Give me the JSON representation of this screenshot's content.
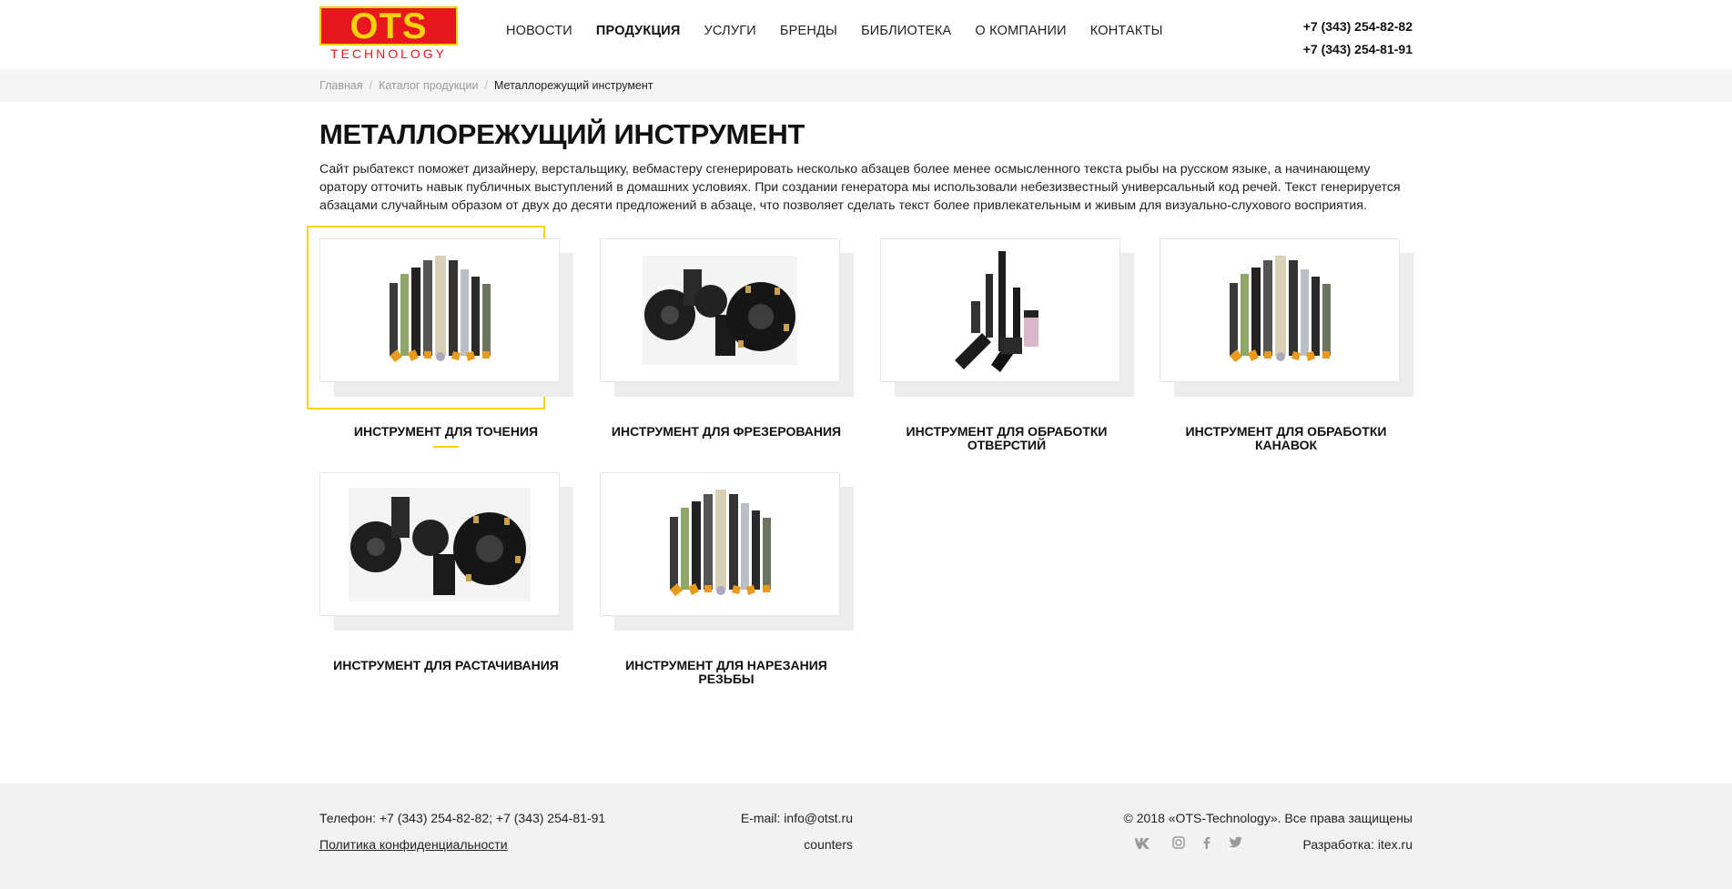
{
  "header": {
    "logo_top": "OTS",
    "logo_bottom": "TECHNOLOGY",
    "nav": [
      {
        "label": "НОВОСТИ",
        "active": false
      },
      {
        "label": "ПРОДУКЦИЯ",
        "active": true
      },
      {
        "label": "УСЛУГИ",
        "active": false
      },
      {
        "label": "БРЕНДЫ",
        "active": false
      },
      {
        "label": "БИБЛИОТЕКА",
        "active": false
      },
      {
        "label": "О КОМПАНИИ",
        "active": false
      },
      {
        "label": "КОНТАКТЫ",
        "active": false
      }
    ],
    "phones": [
      "+7 (343) 254-82-82",
      "+7 (343) 254-81-91"
    ]
  },
  "breadcrumb": {
    "items": [
      "Главная",
      "Каталог продукции"
    ],
    "current": "Металлорежущий инструмент"
  },
  "page": {
    "title": "МЕТАЛЛОРЕЖУЩИЙ ИНСТРУМЕНТ",
    "intro": "Сайт рыбатекст поможет дизайнеру, верстальщику, вебмастеру сгенерировать несколько абзацев более менее осмысленного текста рыбы на русском языке, а начинающему оратору отточить навык публичных выступлений в домашних условиях. При создании генератора мы использовали небезизвестный универсальный код речей. Текст генерируется абзацами случайным образом от двух до десяти предложений в абзаце, что позволяет сделать текст более привлекательным и живым для визуально-слухового восприятия."
  },
  "categories": [
    {
      "caption": "ИНСТРУМЕНТ ДЛЯ ТОЧЕНИЯ",
      "image": "turning-tools-image",
      "highlighted": true
    },
    {
      "caption": "ИНСТРУМЕНТ ДЛЯ ФРЕЗЕРОВАНИЯ",
      "image": "milling-tools-image",
      "highlighted": false
    },
    {
      "caption": "ИНСТРУМЕНТ ДЛЯ ОБРАБОТКИ ОТВЕРСТИЙ",
      "image": "hole-tools-image",
      "highlighted": false
    },
    {
      "caption": "ИНСТРУМЕНТ ДЛЯ ОБРАБОТКИ КАНАВОК",
      "image": "grooving-tools-image",
      "highlighted": false
    },
    {
      "caption": "ИНСТРУМЕНТ ДЛЯ РАСТАЧИВАНИЯ",
      "image": "boring-tools-image",
      "highlighted": false
    },
    {
      "caption": "ИНСТРУМЕНТ ДЛЯ НАРЕЗАНИЯ РЕЗЬБЫ",
      "image": "threading-tools-image",
      "highlighted": false
    }
  ],
  "footer": {
    "phone": "Телефон: +7 (343) 254-82-82; +7 (343) 254-81-91",
    "privacy": "Политика конфиденциальности",
    "email": "E-mail: info@otst.ru",
    "counters": "counters",
    "copyright": "© 2018 «OTS-Technology». Все права защищены",
    "developer": "Разработка: itex.ru",
    "social": [
      "vk-icon",
      "instagram-icon",
      "facebook-icon",
      "twitter-icon"
    ]
  },
  "colors": {
    "brand_red": "#e8161d",
    "brand_yellow": "#f7d40a",
    "footer_bg": "#f2f2f2"
  }
}
